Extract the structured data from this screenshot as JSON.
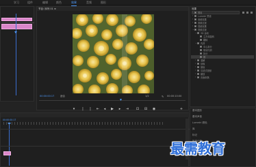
{
  "menu": {
    "items": [
      {
        "label": "学习"
      },
      {
        "label": "组件"
      },
      {
        "label": "编辑"
      },
      {
        "label": "颜色"
      },
      {
        "label": "效果"
      },
      {
        "label": "音频"
      },
      {
        "label": "图形"
      }
    ],
    "active_index": 3
  },
  "program_monitor": {
    "tab": "节目: 序列 01 ≡",
    "timecode_left": "00:00:00:17",
    "fit_label": "适合",
    "quality_label": "1/2",
    "timecode_right": "00:00:10:00"
  },
  "effects_panel": {
    "title": "效果",
    "tree": [
      {
        "label": "预设"
      },
      {
        "label": "Lumetri 预设"
      },
      {
        "label": "音频效果"
      },
      {
        "label": "音频过渡"
      },
      {
        "label": "视频效果"
      },
      {
        "label": "视频过渡"
      },
      {
        "label": "3D 运动"
      },
      {
        "label": "立方体旋转"
      },
      {
        "label": "翻转"
      },
      {
        "label": "内滑"
      },
      {
        "label": "中心拆分"
      },
      {
        "label": "带状内滑"
      },
      {
        "label": "拆分"
      },
      {
        "label": "推"
      },
      {
        "label": "溶解"
      },
      {
        "label": "划像"
      },
      {
        "label": "擦除"
      },
      {
        "label": "沉浸式视频"
      },
      {
        "label": "缩放"
      },
      {
        "label": "页面剥落"
      }
    ],
    "selected_index": 13
  },
  "lower_right": {
    "items": [
      {
        "label": "基本图形"
      },
      {
        "label": "基本声音"
      },
      {
        "label": "Lumetri 颜色"
      },
      {
        "label": "库"
      },
      {
        "label": "标记"
      },
      {
        "label": "历史记录"
      },
      {
        "label": "信息"
      }
    ]
  },
  "timeline": {
    "timecode": "00:00:00:17"
  },
  "watermark": {
    "text": "最需教育"
  },
  "colors": {
    "accent": "#4f9cff",
    "clip_pink": "#d986c9",
    "panel_bg": "#1f1f1f"
  }
}
